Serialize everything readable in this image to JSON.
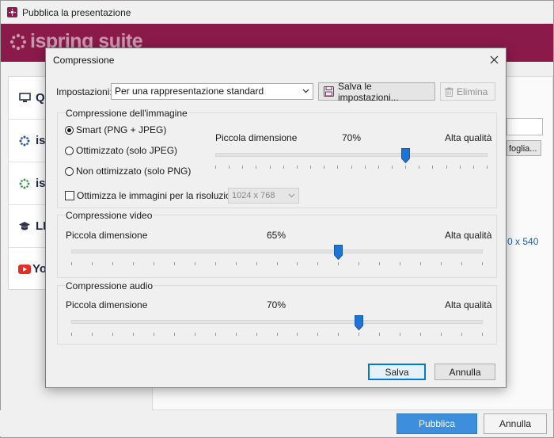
{
  "background_window": {
    "title": "Pubblica la presentazione",
    "logo_text": "ispring suite",
    "sidebar": [
      {
        "label": "Q",
        "icon": "computer-icon"
      },
      {
        "label": "isp",
        "icon": "ispring-icon"
      },
      {
        "label": "isp",
        "icon": "ispring-cloud-icon"
      },
      {
        "label": "LI",
        "icon": "graduation-cap-icon"
      },
      {
        "label": "Yo",
        "icon": "youtube-icon"
      }
    ],
    "browse_label": "foglia...",
    "size_text": "0 x 540",
    "publish_label": "Pubblica",
    "cancel_label": "Annulla"
  },
  "dialog": {
    "title": "Compressione",
    "settings": {
      "label": "Impostazioni:",
      "selected": "Per una rappresentazione standard",
      "save_label": "Salva le impostazioni...",
      "delete_label": "Elimina"
    },
    "image": {
      "title": "Compressione dell'immagine",
      "options": [
        {
          "label": "Smart (PNG + JPEG)",
          "selected": true
        },
        {
          "label": "Ottimizzato (solo JPEG)",
          "selected": false
        },
        {
          "label": "Non ottimizzato (solo PNG)",
          "selected": false
        }
      ],
      "optimize_label": "Ottimizza le immagini per la risoluzione:",
      "optimize_checked": false,
      "resolution": "1024 x 768",
      "slider": {
        "min_label": "Piccola dimensione",
        "max_label": "Alta qualità",
        "value_text": "70%",
        "value": 0.7
      }
    },
    "video": {
      "title": "Compressione video",
      "slider": {
        "min_label": "Piccola dimensione",
        "max_label": "Alta qualità",
        "value_text": "65%",
        "value": 0.65
      }
    },
    "audio": {
      "title": "Compressione audio",
      "slider": {
        "min_label": "Piccola dimensione",
        "max_label": "Alta qualità",
        "value_text": "70%",
        "value": 0.7
      }
    },
    "ok_label": "Salva",
    "cancel_label": "Annulla"
  },
  "colors": {
    "brand": "#8a1a4a",
    "accent": "#0078d7",
    "slider_thumb": "#1e73d6",
    "publish_button": "#3e8ede",
    "link_text": "#1f5fa8"
  }
}
